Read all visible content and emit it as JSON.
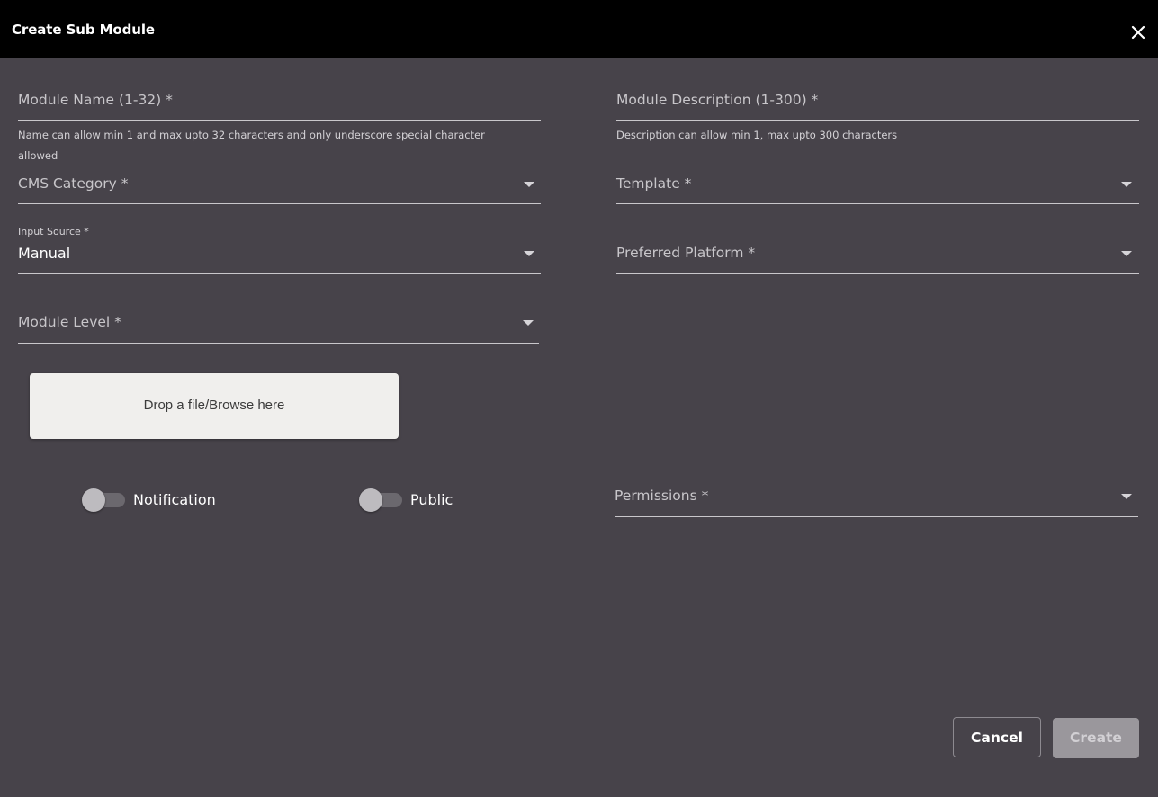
{
  "dialog": {
    "title": "Create Sub Module",
    "close_icon": "close-icon"
  },
  "form": {
    "module_name": {
      "label": "Module Name (1-32) *",
      "hint": "Name can allow min 1 and max upto 32 characters and only underscore special character allowed"
    },
    "module_description": {
      "label": "Module Description (1-300) *",
      "hint": "Description can allow min 1, max upto 300 characters"
    },
    "cms_category": {
      "label": "CMS Category *"
    },
    "template": {
      "label": "Template *"
    },
    "input_source": {
      "label": "Input Source *",
      "value": "Manual"
    },
    "preferred_platform": {
      "label": "Preferred Platform *"
    },
    "module_level": {
      "label": "Module Level *"
    },
    "dropzone": {
      "label": "Drop a file/Browse here"
    },
    "notification": {
      "label": "Notification",
      "on": false
    },
    "public": {
      "label": "Public",
      "on": false
    },
    "permissions": {
      "label": "Permissions *"
    }
  },
  "actions": {
    "cancel_label": "Cancel",
    "create_label": "Create"
  },
  "colors": {
    "background": "#47434a",
    "header": "#000000",
    "dropzone": "#f0efed",
    "create_disabled": "#9a979c"
  }
}
